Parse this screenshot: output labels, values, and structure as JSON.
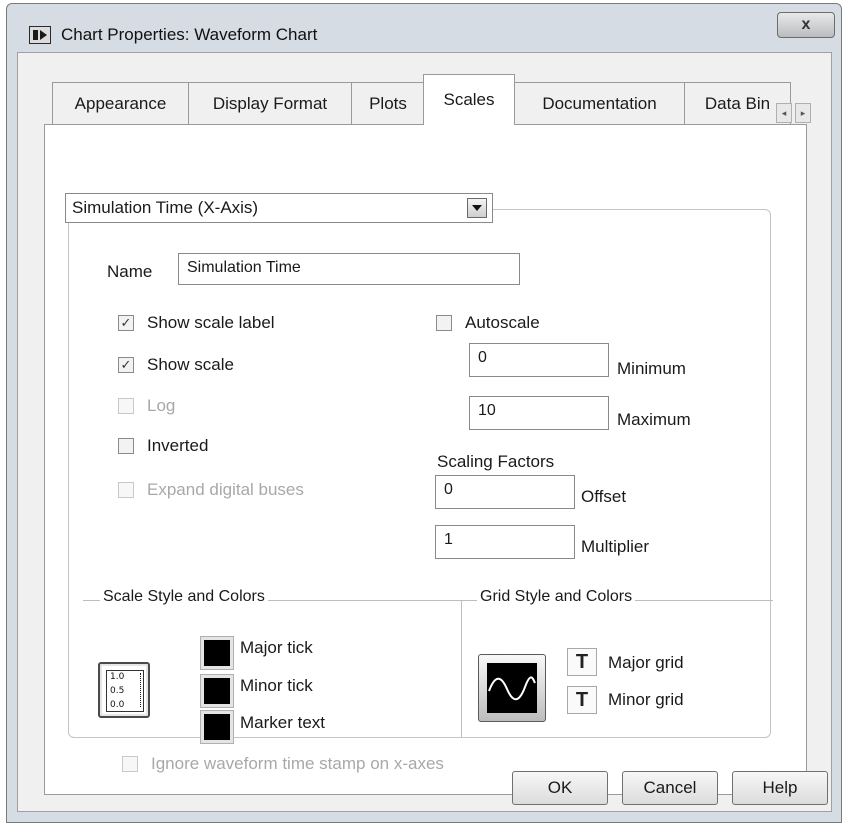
{
  "window": {
    "title": "Chart Properties: Waveform Chart",
    "close_glyph": "x"
  },
  "tabs": [
    {
      "label": "Appearance",
      "active": false
    },
    {
      "label": "Display Format",
      "active": false
    },
    {
      "label": "Plots",
      "active": false
    },
    {
      "label": "Scales",
      "active": true
    },
    {
      "label": "Documentation",
      "active": false
    },
    {
      "label": "Data Bin",
      "active": false
    }
  ],
  "tab_nav": {
    "prev_glyph": "◂",
    "next_glyph": "▸"
  },
  "axis_select": {
    "value": "Simulation Time (X-Axis)"
  },
  "name_field": {
    "label": "Name",
    "value": "Simulation Time"
  },
  "options": {
    "show_scale_label": {
      "label": "Show scale label",
      "checked": true,
      "enabled": true
    },
    "show_scale": {
      "label": "Show scale",
      "checked": true,
      "enabled": true
    },
    "log": {
      "label": "Log",
      "checked": false,
      "enabled": false
    },
    "inverted": {
      "label": "Inverted",
      "checked": false,
      "enabled": true
    },
    "expand_digital_buses": {
      "label": "Expand digital buses",
      "checked": false,
      "enabled": false
    },
    "autoscale": {
      "label": "Autoscale",
      "checked": false,
      "enabled": true
    }
  },
  "check_glyph": "✓",
  "range": {
    "minimum": {
      "label": "Minimum",
      "value": "0"
    },
    "maximum": {
      "label": "Maximum",
      "value": "10"
    }
  },
  "scaling_factors": {
    "title": "Scaling Factors",
    "offset": {
      "label": "Offset",
      "value": "0"
    },
    "multiplier": {
      "label": "Multiplier",
      "value": "1"
    }
  },
  "scale_style": {
    "title": "Scale Style and Colors",
    "icon_ticks": [
      "1.0",
      "0.5",
      "0.0"
    ],
    "colors": [
      {
        "label": "Major tick",
        "color": "#000000"
      },
      {
        "label": "Minor tick",
        "color": "#000000"
      },
      {
        "label": "Marker text",
        "color": "#000000"
      }
    ]
  },
  "grid_style": {
    "title": "Grid Style and Colors",
    "glyph": "T",
    "items": [
      {
        "label": "Major grid"
      },
      {
        "label": "Minor grid"
      }
    ]
  },
  "ignore_timestamp": {
    "label": "Ignore waveform time stamp on x-axes",
    "checked": false,
    "enabled": false
  },
  "buttons": {
    "ok": "OK",
    "cancel": "Cancel",
    "help": "Help"
  }
}
